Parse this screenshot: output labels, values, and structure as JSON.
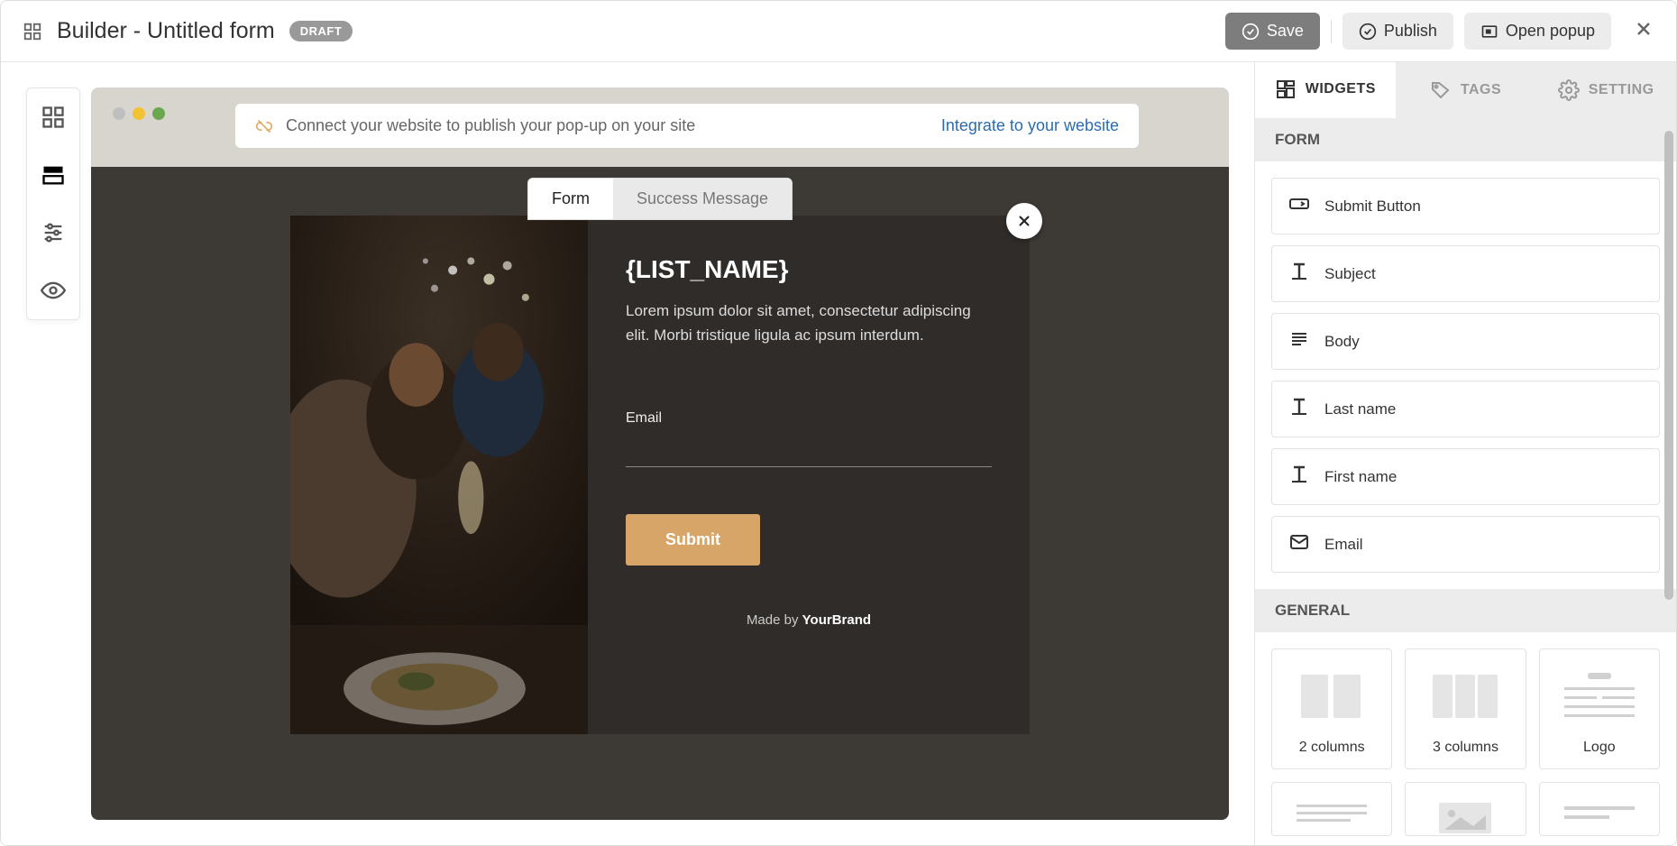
{
  "header": {
    "title": "Builder - Untitled form",
    "badge": "DRAFT",
    "save": "Save",
    "publish": "Publish",
    "open_popup": "Open popup"
  },
  "banner": {
    "text": "Connect your website to publish your pop-up on your site",
    "link": "Integrate to your website"
  },
  "preview": {
    "tab_form": "Form",
    "tab_success": "Success Message"
  },
  "popup": {
    "title": "{LIST_NAME}",
    "desc": "Lorem ipsum dolor sit amet, consectetur adipiscing elit. Morbi tristique ligula ac ipsum interdum.",
    "email_label": "Email",
    "submit": "Submit",
    "made_by": "Made by ",
    "brand": "YourBrand"
  },
  "panel": {
    "tab_widgets": "WIDGETS",
    "tab_tags": "TAGS",
    "tab_setting": "SETTING",
    "section_form": "FORM",
    "section_general": "GENERAL",
    "widgets_form": [
      {
        "icon": "submit",
        "label": "Submit Button"
      },
      {
        "icon": "text",
        "label": "Subject"
      },
      {
        "icon": "body",
        "label": "Body"
      },
      {
        "icon": "text",
        "label": "Last name"
      },
      {
        "icon": "text",
        "label": "First name"
      },
      {
        "icon": "mail",
        "label": "Email"
      }
    ],
    "widgets_general": [
      {
        "label": "2 columns"
      },
      {
        "label": "3 columns"
      },
      {
        "label": "Logo"
      }
    ]
  }
}
